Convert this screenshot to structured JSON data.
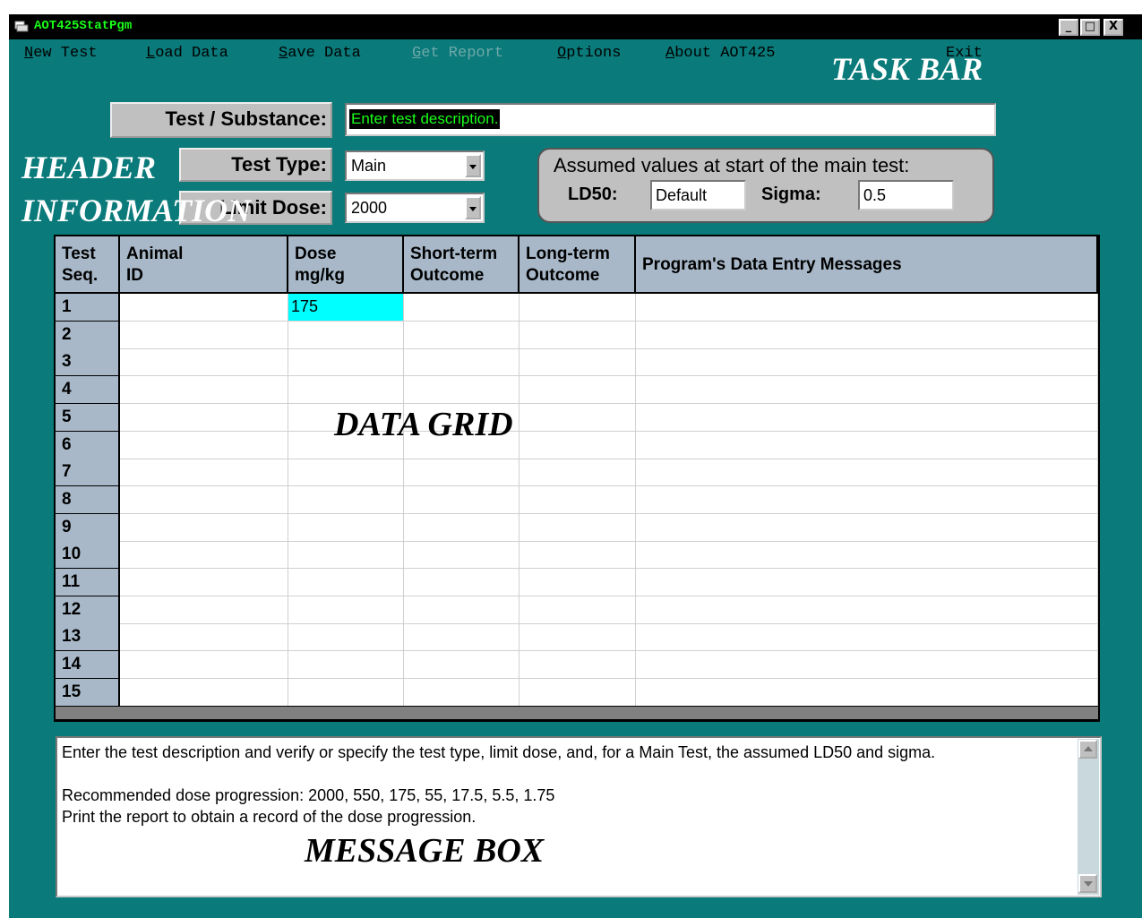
{
  "window": {
    "title": "AOT425StatPgm",
    "buttons": {
      "minimize": "_",
      "maximize": "□",
      "close": "X"
    }
  },
  "menu": [
    {
      "label": "New Test",
      "key": "N",
      "rest": "ew Test",
      "enabled": true
    },
    {
      "label": "Load Data",
      "key": "L",
      "rest": "oad Data",
      "enabled": true
    },
    {
      "label": "Save Data",
      "key": "S",
      "rest": "ave Data",
      "enabled": true
    },
    {
      "label": "Get Report",
      "key": "G",
      "rest": "et Report",
      "enabled": false
    },
    {
      "label": "Options",
      "key": "O",
      "rest": "ptions",
      "enabled": true
    },
    {
      "label": "About AOT425",
      "key": "A",
      "rest": "bout AOT425",
      "enabled": true
    },
    {
      "label": "Exit",
      "key": "",
      "rest": "Exit",
      "enabled": true
    }
  ],
  "annotations": {
    "task_bar": "TASK BAR",
    "header_1": "HEADER",
    "header_2": "INFORMATION",
    "data_grid": "DATA GRID",
    "message_box": "MESSAGE BOX"
  },
  "header": {
    "test_substance_label": "Test / Substance:",
    "test_substance_value": "Enter test description.",
    "test_type_label": "Test Type:",
    "test_type_value": "Main",
    "limit_dose_label": "Limit Dose:",
    "limit_dose_value": "2000"
  },
  "assumed": {
    "title": "Assumed values at start of the main test:",
    "ld50_label": "LD50:",
    "ld50_value": "Default",
    "sigma_label": "Sigma:",
    "sigma_value": "0.5"
  },
  "grid": {
    "columns": [
      {
        "line1": "Test",
        "line2": "Seq."
      },
      {
        "line1": "Animal",
        "line2": "ID"
      },
      {
        "line1": "Dose",
        "line2": "mg/kg"
      },
      {
        "line1": "Short-term",
        "line2": "Outcome"
      },
      {
        "line1": "Long-term",
        "line2": "Outcome"
      },
      {
        "line1": "Program's Data Entry Messages",
        "line2": ""
      }
    ],
    "rows": [
      {
        "seq": "1",
        "animal_id": "",
        "dose": "175",
        "short": "",
        "long": "",
        "msg": ""
      },
      {
        "seq": "2",
        "animal_id": "",
        "dose": "",
        "short": "",
        "long": "",
        "msg": ""
      },
      {
        "seq": "3",
        "animal_id": "",
        "dose": "",
        "short": "",
        "long": "",
        "msg": ""
      },
      {
        "seq": "4",
        "animal_id": "",
        "dose": "",
        "short": "",
        "long": "",
        "msg": ""
      },
      {
        "seq": "5",
        "animal_id": "",
        "dose": "",
        "short": "",
        "long": "",
        "msg": ""
      },
      {
        "seq": "6",
        "animal_id": "",
        "dose": "",
        "short": "",
        "long": "",
        "msg": ""
      },
      {
        "seq": "7",
        "animal_id": "",
        "dose": "",
        "short": "",
        "long": "",
        "msg": ""
      },
      {
        "seq": "8",
        "animal_id": "",
        "dose": "",
        "short": "",
        "long": "",
        "msg": ""
      },
      {
        "seq": "9",
        "animal_id": "",
        "dose": "",
        "short": "",
        "long": "",
        "msg": ""
      },
      {
        "seq": "10",
        "animal_id": "",
        "dose": "",
        "short": "",
        "long": "",
        "msg": ""
      },
      {
        "seq": "11",
        "animal_id": "",
        "dose": "",
        "short": "",
        "long": "",
        "msg": ""
      },
      {
        "seq": "12",
        "animal_id": "",
        "dose": "",
        "short": "",
        "long": "",
        "msg": ""
      },
      {
        "seq": "13",
        "animal_id": "",
        "dose": "",
        "short": "",
        "long": "",
        "msg": ""
      },
      {
        "seq": "14",
        "animal_id": "",
        "dose": "",
        "short": "",
        "long": "",
        "msg": ""
      },
      {
        "seq": "15",
        "animal_id": "",
        "dose": "",
        "short": "",
        "long": "",
        "msg": ""
      }
    ]
  },
  "messages": {
    "line1": "Enter the test description and verify or specify the test type, limit dose, and, for a Main Test, the assumed LD50 and sigma.",
    "line2": "Recommended dose progression: 2000, 550, 175, 55, 17.5, 5.5, 1.75",
    "line3": "Print the report to obtain a record of the dose progression."
  },
  "colors": {
    "window_bg": "#0a7a7a",
    "title_text": "#1aff1a",
    "grid_header": "#a8b8c8",
    "active_cell": "#00ffff"
  }
}
